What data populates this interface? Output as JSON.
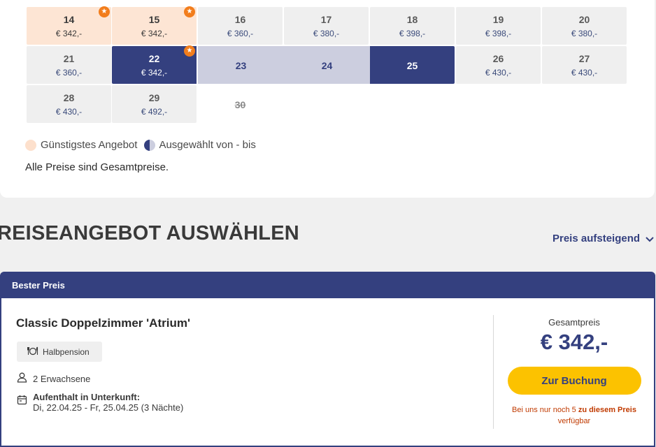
{
  "calendar": {
    "rows": [
      [
        {
          "day": "14",
          "price": "€ 342,-",
          "state": "cheap",
          "star": true
        },
        {
          "day": "15",
          "price": "€ 342,-",
          "state": "cheap",
          "star": true
        },
        {
          "day": "16",
          "price": "€ 360,-",
          "state": "normal"
        },
        {
          "day": "17",
          "price": "€ 380,-",
          "state": "normal"
        },
        {
          "day": "18",
          "price": "€ 398,-",
          "state": "normal"
        },
        {
          "day": "19",
          "price": "€ 398,-",
          "state": "normal"
        },
        {
          "day": "20",
          "price": "€ 380,-",
          "state": "normal"
        }
      ],
      [
        {
          "day": "21",
          "price": "€ 360,-",
          "state": "normal"
        },
        {
          "day": "22",
          "price": "€ 342,-",
          "state": "selected-start",
          "star": true
        },
        {
          "day": "23",
          "price": "",
          "state": "range"
        },
        {
          "day": "24",
          "price": "",
          "state": "range"
        },
        {
          "day": "25",
          "price": "",
          "state": "selected-end"
        },
        {
          "day": "26",
          "price": "€ 430,-",
          "state": "normal"
        },
        {
          "day": "27",
          "price": "€ 430,-",
          "state": "normal"
        }
      ],
      [
        {
          "day": "28",
          "price": "€ 430,-",
          "state": "normal"
        },
        {
          "day": "29",
          "price": "€ 492,-",
          "state": "normal"
        },
        {
          "day": "30",
          "price": "",
          "state": "disabled"
        }
      ]
    ],
    "star_glyph": "★",
    "legend": {
      "cheapest_label": "Günstigstes Angebot",
      "selected_label": "Ausgewählt von - bis"
    },
    "note": "Alle Preise sind Gesamtpreise."
  },
  "section": {
    "title": "REISEANGEBOT AUSWÄHLEN",
    "sort_label": "Preis aufsteigend",
    "sort_icon": "chevron-down-icon"
  },
  "offer": {
    "header": "Bester Preis",
    "room_name": "Classic Doppelzimmer 'Atrium'",
    "board": "Halbpension",
    "board_icon": "cutlery-icon",
    "persons": "2 Erwachsene",
    "persons_icon": "person-icon",
    "stay_label": "Aufenthalt in Unterkunft:",
    "stay_dates": "Di, 22.04.25 - Fr, 25.04.25 (3 Nächte)",
    "stay_icon": "calendar-icon",
    "total_label": "Gesamtpreis",
    "total_price": "€ 342,-",
    "book_button": "Zur Buchung",
    "availability_prefix": "Bei uns nur noch 5 ",
    "availability_bold": "zu diesem Preis",
    "availability_suffix": "verfügbar"
  },
  "colors": {
    "brand": "#34407f",
    "cheap": "#fde5d4",
    "star": "#f27d1c",
    "button": "#fcc200",
    "warning": "#c03a00"
  }
}
